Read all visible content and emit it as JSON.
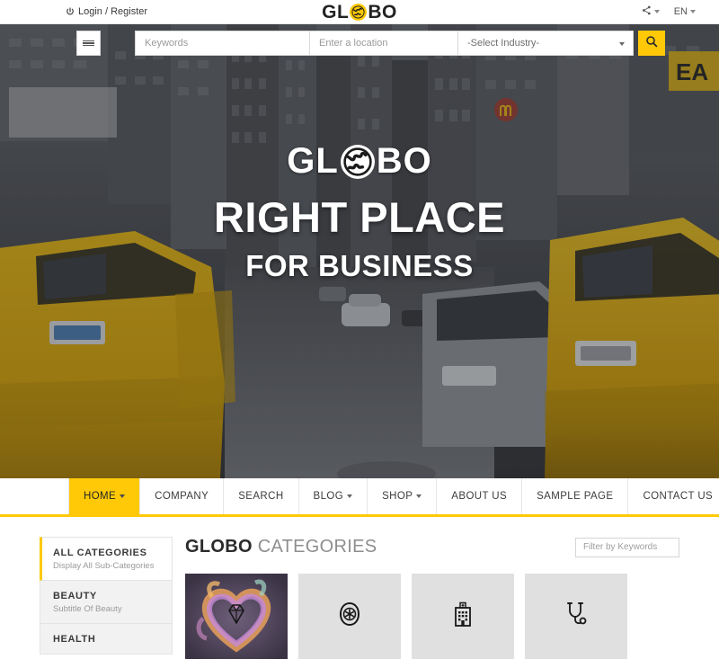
{
  "topbar": {
    "login_label": "Login / Register",
    "power_icon": "power-icon",
    "share_icon": "share-icon",
    "language_label": "EN",
    "logo": {
      "left": "GL",
      "right": "BO",
      "globe_icon": "globe-icon",
      "globe_color": "#FFC907"
    }
  },
  "search": {
    "menu_icon": "hamburger-icon",
    "keywords_placeholder": "Keywords",
    "location_placeholder": "Enter a location",
    "industry_selected": "-Select Industry-",
    "submit_icon": "search-icon",
    "submit_color": "#FFC907"
  },
  "hero": {
    "logo_left": "GL",
    "logo_right": "BO",
    "globe_icon": "globe-icon",
    "headline": "RIGHT PLACE",
    "subheadline": "FOR BUSINESS"
  },
  "nav": {
    "accent_color": "#FFC907",
    "items": [
      {
        "label": "HOME",
        "has_caret": true,
        "active": true
      },
      {
        "label": "COMPANY",
        "has_caret": false,
        "active": false
      },
      {
        "label": "SEARCH",
        "has_caret": false,
        "active": false
      },
      {
        "label": "BLOG",
        "has_caret": true,
        "active": false
      },
      {
        "label": "SHOP",
        "has_caret": true,
        "active": false
      },
      {
        "label": "ABOUT US",
        "has_caret": false,
        "active": false
      },
      {
        "label": "SAMPLE PAGE",
        "has_caret": false,
        "active": false
      },
      {
        "label": "CONTACT US",
        "has_caret": false,
        "active": false
      }
    ]
  },
  "categories_section": {
    "title_bold": "GLOBO",
    "title_light": "CATEGORIES",
    "filter_placeholder": "Filter by Keywords",
    "sidebar": [
      {
        "title": "ALL CATEGORIES",
        "subtitle": "Display All Sub-Categories",
        "active": true
      },
      {
        "title": "BEAUTY",
        "subtitle": "Subtitle Of Beauty",
        "active": false
      },
      {
        "title": "HEALTH",
        "subtitle": "",
        "active": false
      }
    ],
    "cards": [
      {
        "icon": "diamond-icon",
        "label": "",
        "has_photo": true
      },
      {
        "icon": "shield-badge-icon",
        "label": "",
        "has_photo": false
      },
      {
        "icon": "hospital-icon",
        "label": "",
        "has_photo": false
      },
      {
        "icon": "stethoscope-icon",
        "label": "",
        "has_photo": false
      }
    ]
  }
}
